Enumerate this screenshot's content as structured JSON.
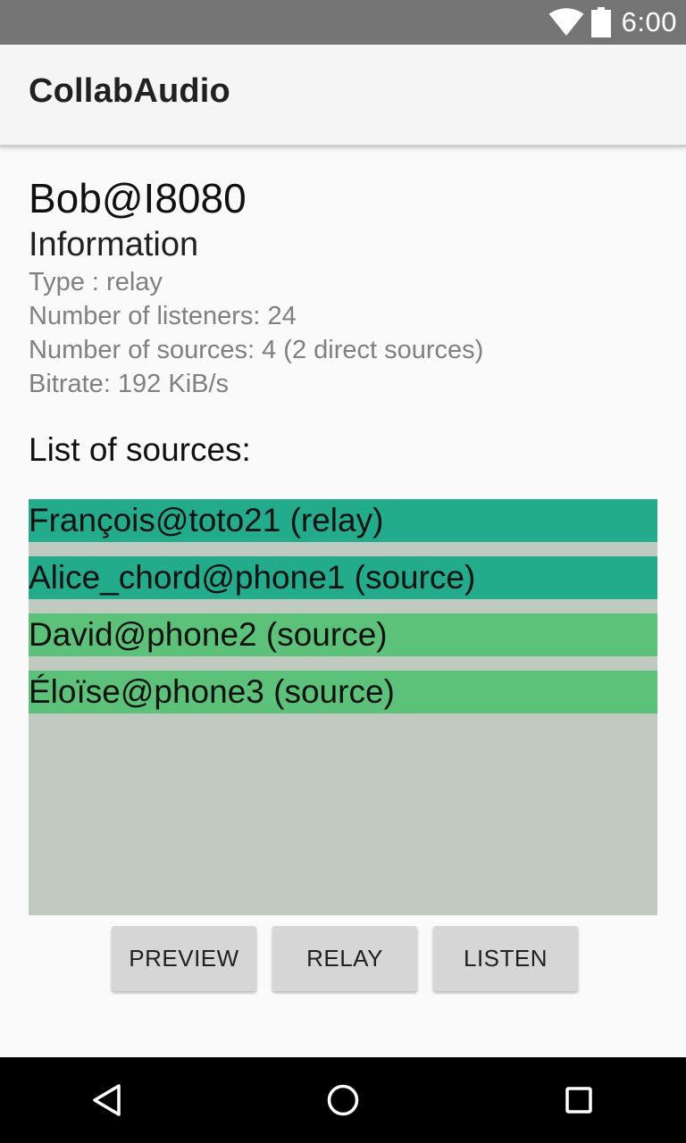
{
  "status_bar": {
    "time": "6:00",
    "icons": [
      "wifi-icon",
      "battery-icon"
    ]
  },
  "app_bar": {
    "title": "CollabAudio"
  },
  "node": {
    "name": "Bob@I8080",
    "info_heading": "Information",
    "type": "Type : relay",
    "listeners": "Number of listeners: 24",
    "sources": "Number of sources: 4 (2 direct sources)",
    "bitrate": "Bitrate: 192 KiB/s"
  },
  "sources_list": {
    "heading": "List of sources:",
    "items": [
      {
        "label": "François@toto21 (relay)",
        "kind": "relay"
      },
      {
        "label": "Alice_chord@phone1 (source)",
        "kind": "relay"
      },
      {
        "label": "David@phone2 (source)",
        "kind": "source"
      },
      {
        "label": "Éloïse@phone3 (source)",
        "kind": "source"
      }
    ]
  },
  "buttons": {
    "preview": "PREVIEW",
    "relay": "RELAY",
    "listen": "LISTEN"
  },
  "colors": {
    "status_bar": "#757575",
    "app_bar": "#f5f5f5",
    "list_background": "#c0cac0",
    "item_dark_green": "#22ac8b",
    "item_light_green": "#5cc27a",
    "button": "#d6d6d6",
    "nav_bar": "#000000"
  },
  "nav_bar": {
    "icons": [
      "back-icon",
      "home-icon",
      "recents-icon"
    ]
  }
}
